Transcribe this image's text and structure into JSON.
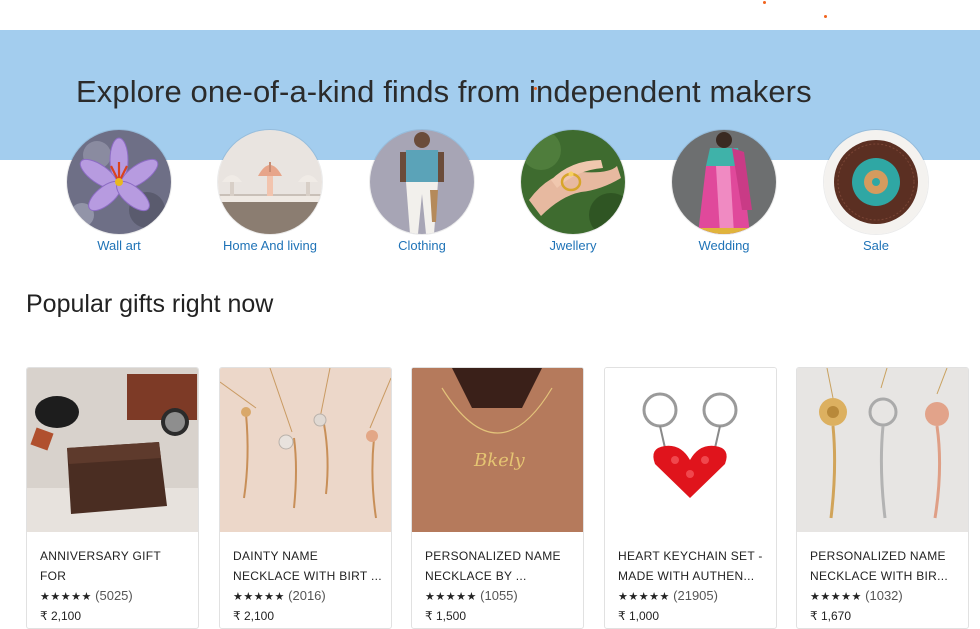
{
  "hero": {
    "title": "Explore one-of-a-kind finds from independent makers"
  },
  "categories": [
    {
      "label": "Wall art",
      "icon": "saffron-flower-photo"
    },
    {
      "label": "Home And living",
      "icon": "table-lamps-photo"
    },
    {
      "label": "Clothing",
      "icon": "model-outfit-photo"
    },
    {
      "label": "Jwellery",
      "icon": "ring-hand-photo"
    },
    {
      "label": "Wedding",
      "icon": "saree-model-photo"
    },
    {
      "label": "Sale",
      "icon": "plate-photo"
    }
  ],
  "section": {
    "title": "Popular gifts right now"
  },
  "products": [
    {
      "title": "ANNIVERSARY GIFT FOR HIM,PERSONALIZED ...",
      "stars": "★★★★★",
      "reviews": "(5025)",
      "price": "₹ 2,100"
    },
    {
      "title": "DAINTY NAME NECKLACE WITH BIRT ...",
      "stars": "★★★★★",
      "reviews": "(2016)",
      "price": "₹ 2,100"
    },
    {
      "title": "PERSONALIZED NAME NECKLACE BY ...",
      "stars": "★★★★★",
      "reviews": "(1055)",
      "price": "₹ 1,500"
    },
    {
      "title": "HEART KEYCHAIN SET - MADE WITH AUTHEN...",
      "stars": "★★★★★",
      "reviews": "(21905)",
      "price": "₹ 1,000"
    },
    {
      "title": "PERSONALIZED NAME NECKLACE WITH BIR...",
      "stars": "★★★★★",
      "reviews": "(1032)",
      "price": "₹ 1,670"
    }
  ],
  "colors": {
    "hero_bg": "#a3cdee",
    "link": "#1f73b7",
    "accent_dot": "#f1641e"
  }
}
